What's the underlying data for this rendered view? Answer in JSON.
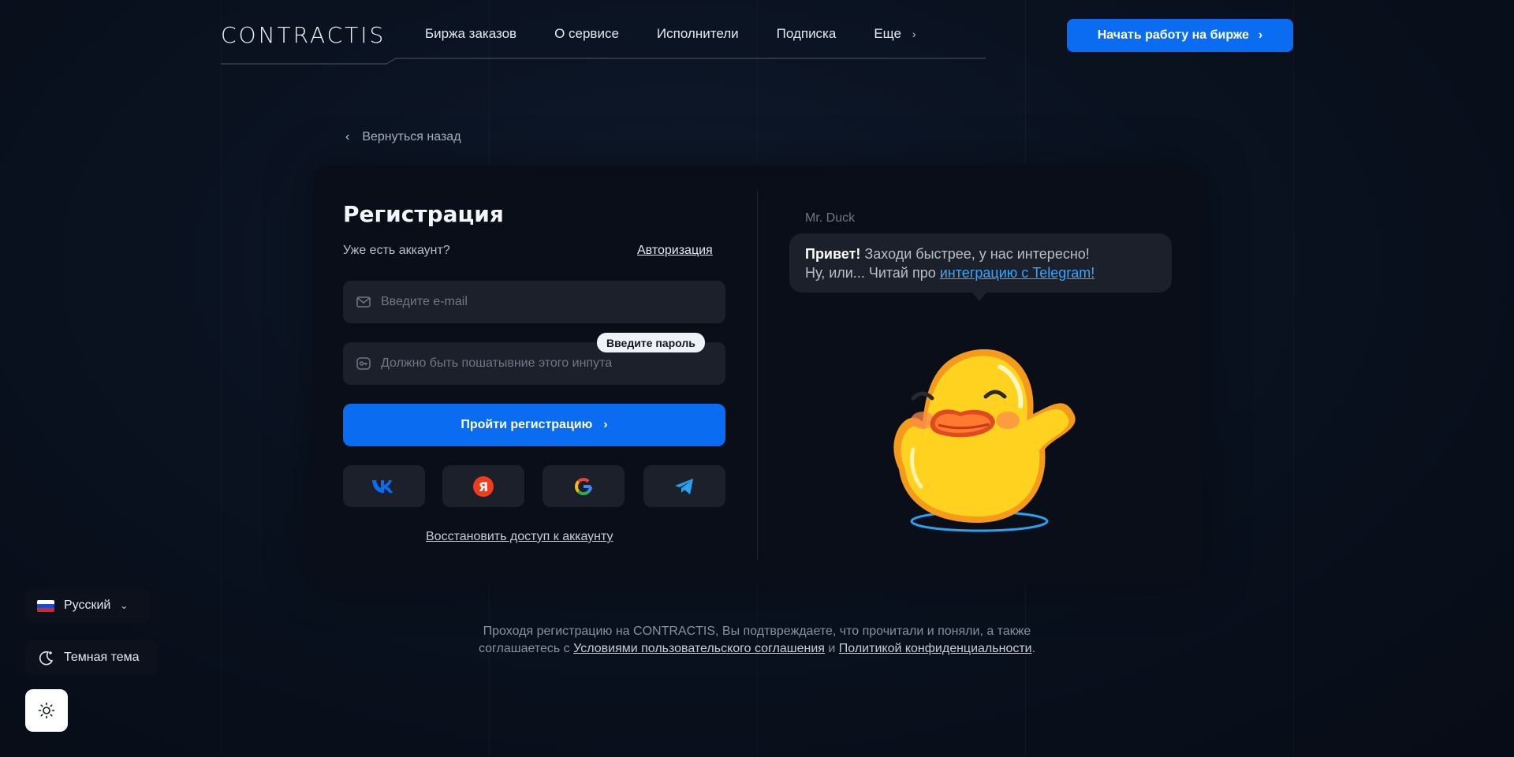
{
  "header": {
    "logo": "CONTRACTIS",
    "nav": [
      "Биржа заказов",
      "О сервисе",
      "Исполнители",
      "Подписка",
      "Еще"
    ],
    "cta": "Начать работу на бирже"
  },
  "back_label": "Вернуться назад",
  "form": {
    "title": "Регистрация",
    "have_account": "Уже есть аккаунт?",
    "auth_link": "Авторизация",
    "email_placeholder": "Введите e-mail",
    "password_placeholder": "Должно быть пошатывние этого инпута",
    "password_tooltip": "Введите пароль",
    "submit": "Пройти регистрацию",
    "social": [
      "vk-icon",
      "yandex-icon",
      "google-icon",
      "telegram-icon"
    ],
    "restore": "Восстановить доступ к аккаунту"
  },
  "chat": {
    "bot_name": "Mr. Duck",
    "greeting_bold": "Привет!",
    "greeting_rest": " Заходи быстрее, у нас интересно!",
    "line2_prefix": "Ну, или... Читай про ",
    "line2_link": "интеграцию с Telegram!"
  },
  "legal": {
    "line1": "Проходя регистрацию на CONTRACTIS, Вы подтвреждаете, что прочитали и поняли, а также",
    "line2_prefix": "соглашаетесь с ",
    "terms_link": "Условиями пользовательского соглашения",
    "and": " и ",
    "privacy_link": "Политикой конфиденциальности",
    "end": "."
  },
  "widgets": {
    "language": "Русский",
    "theme": "Темная тема"
  },
  "colors": {
    "accent": "#0a6cf0",
    "background": "#0a1220",
    "card": "#090e19",
    "field": "#1b202b",
    "telegram_link": "#3aa6f5"
  }
}
